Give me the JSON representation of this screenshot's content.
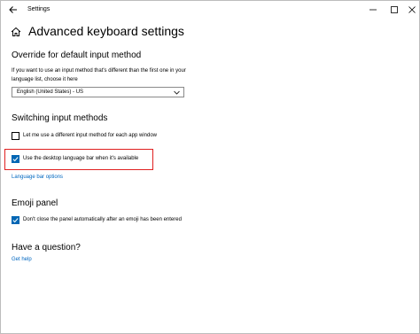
{
  "window": {
    "app_title": "Settings"
  },
  "header": {
    "title": "Advanced keyboard settings"
  },
  "override": {
    "heading": "Override for default input method",
    "description": "If you want to use an input method that's different than the first one in your language list, choose it here",
    "selected_value": "English (United States) - US"
  },
  "switching": {
    "heading": "Switching input methods",
    "option1_label": "Let me use a different input method for each app window",
    "option1_checked": false,
    "option2_label": "Use the desktop language bar when it's available",
    "option2_checked": true,
    "link_label": "Language bar options"
  },
  "emoji": {
    "heading": "Emoji panel",
    "option_label": "Don't close the panel automatically after an emoji has been entered",
    "option_checked": true
  },
  "help": {
    "heading": "Have a question?",
    "link_label": "Get help"
  },
  "colors": {
    "accent": "#0066b4",
    "link": "#0067c0",
    "highlight": "#e02020"
  },
  "icons": {
    "back": "back-arrow-icon",
    "home": "home-icon",
    "minimize": "minimize-icon",
    "maximize": "maximize-icon",
    "close": "close-icon",
    "dropdown": "chevron-down-icon",
    "check": "checkmark-icon"
  }
}
